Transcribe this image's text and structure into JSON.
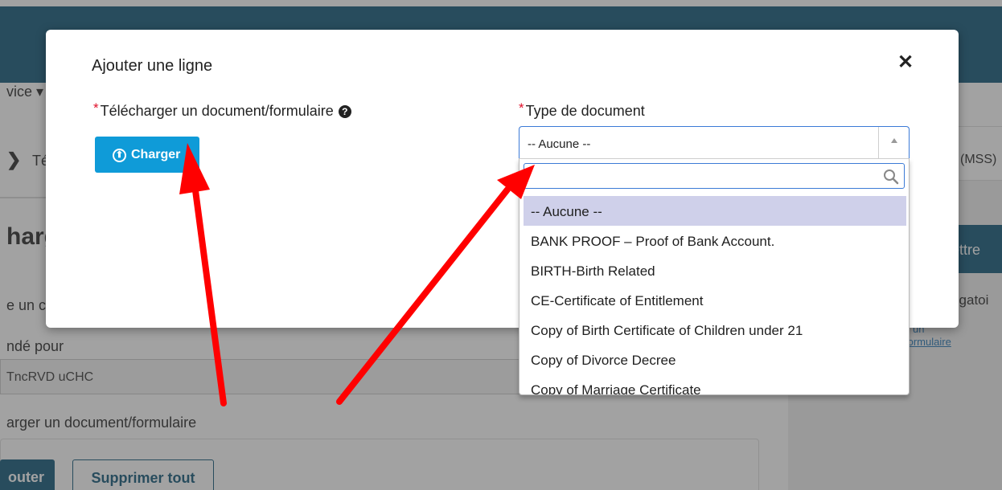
{
  "background": {
    "menu_partial": "vice ▾",
    "chevron": "❯",
    "breadcrumb_partial": "Té",
    "heading_partial": "harg",
    "line1_partial": "e un c",
    "line2_partial": "ndé pour",
    "input_value_partial": "TncRVD uCHC",
    "line3_partial": "arger un document/formulaire",
    "btn_add_partial": "outer",
    "btn_remove_all": "Supprimer tout",
    "side_mss": "(MSS)",
    "side_button_partial": "ettre",
    "side_oblig_partial": "ligatoi",
    "side_link1": "un",
    "side_link2": "formulaire",
    "colors": {
      "header": "#0b5275",
      "accent": "#0b5275"
    }
  },
  "modal": {
    "title": "Ajouter une ligne",
    "close_glyph": "✕",
    "required_mark": "*",
    "upload_label": "Télécharger un document/formulaire",
    "help_glyph": "?",
    "upload_button": "Charger",
    "upload_icon_glyph": "⬆",
    "type_label": "Type de document",
    "select_value": "-- Aucune --",
    "search": {
      "value": "",
      "placeholder": ""
    },
    "options": [
      "-- Aucune --",
      "BANK PROOF – Proof of Bank Account.",
      "BIRTH-Birth Related",
      "CE-Certificate of Entitlement",
      "Copy of Birth Certificate of Children under 21",
      "Copy of Divorce Decree",
      "Copy of Marriage Certificate"
    ],
    "selected_index": 0,
    "colors": {
      "button": "#0f9bd8",
      "required": "#e0102a",
      "focus": "#3b7ad6",
      "highlight": "#cfd0ea"
    }
  },
  "annotations": {
    "arrow_color": "#ff0000"
  }
}
